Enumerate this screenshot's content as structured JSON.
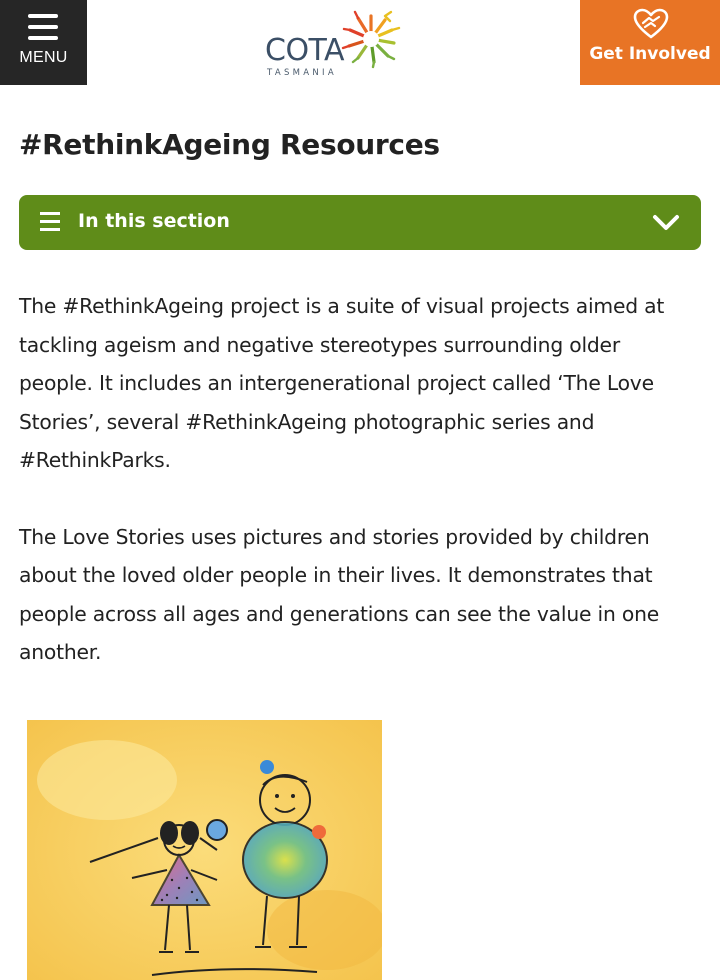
{
  "header": {
    "menu_label": "MENU",
    "logo": {
      "name": "COTA",
      "subtitle": "TASMANIA"
    },
    "cta_label": "Get Involved",
    "cta_color": "#e87425"
  },
  "page": {
    "title": "#RethinkAgeing Resources",
    "section_toggle_label": "In this section",
    "section_color": "#5f8c19"
  },
  "content": {
    "paragraphs": [
      "The #RethinkAgeing project is a suite of visual projects aimed at tackling ageism and negative stereotypes surrounding older people. It includes an intergenerational project called ‘The Love Stories’, several #RethinkAgeing photographic series and #RethinkParks.",
      "The Love Stories uses pictures and stories provided by children about the loved older people in their lives. It demonstrates that people across all ages and generations can see the value in one another."
    ]
  },
  "icons": {
    "menu": "hamburger-icon",
    "cta": "heart-hands-icon",
    "section": "list-icon",
    "toggle": "chevron-down-icon"
  }
}
